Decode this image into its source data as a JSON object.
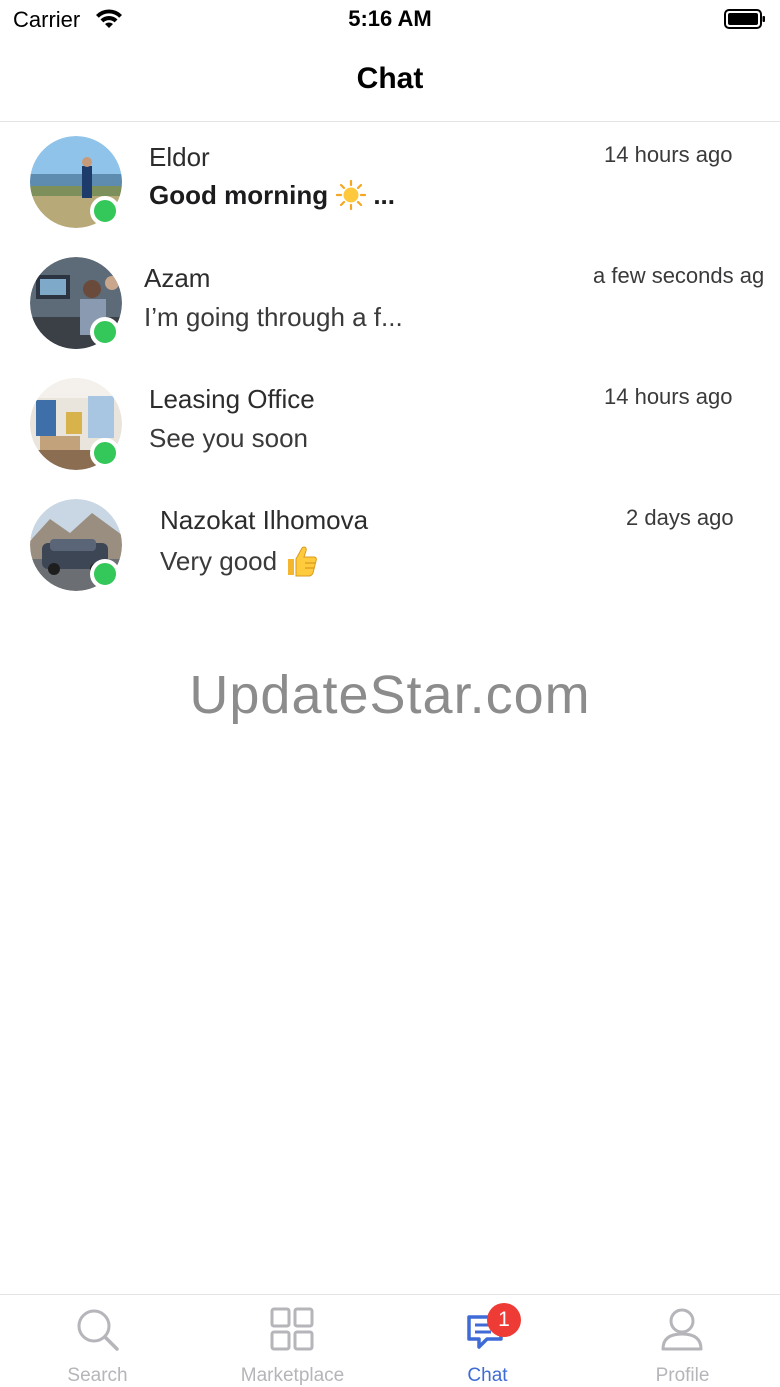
{
  "status_bar": {
    "carrier": "Carrier",
    "time": "5:16 AM"
  },
  "header": {
    "title": "Chat"
  },
  "chats": [
    {
      "name": "Eldor",
      "preview": "Good morning",
      "preview_suffix": "...",
      "time": "14 hours ago",
      "online": true,
      "unread": true,
      "emoji": "sun"
    },
    {
      "name": "Azam",
      "preview": "I’m going through a f...",
      "time": "a few seconds ag",
      "online": true,
      "unread": false
    },
    {
      "name": "Leasing Office",
      "preview": "See you soon",
      "time": "14 hours ago",
      "online": true,
      "unread": false
    },
    {
      "name": "Nazokat Ilhomova",
      "preview": "Very good",
      "time": "2 days ago",
      "online": true,
      "unread": false,
      "emoji": "thumbs-up"
    }
  ],
  "watermark": "UpdateStar.com",
  "tab_bar": {
    "tabs": [
      {
        "label": "Search",
        "icon": "search-icon",
        "active": false
      },
      {
        "label": "Marketplace",
        "icon": "grid-icon",
        "active": false
      },
      {
        "label": "Chat",
        "icon": "chat-icon",
        "active": true,
        "badge": "1"
      },
      {
        "label": "Profile",
        "icon": "profile-icon",
        "active": false
      }
    ]
  },
  "colors": {
    "accent": "#3f6bd6",
    "online": "#34c759",
    "badge": "#ee3b36",
    "inactive": "#b5b5ba"
  }
}
